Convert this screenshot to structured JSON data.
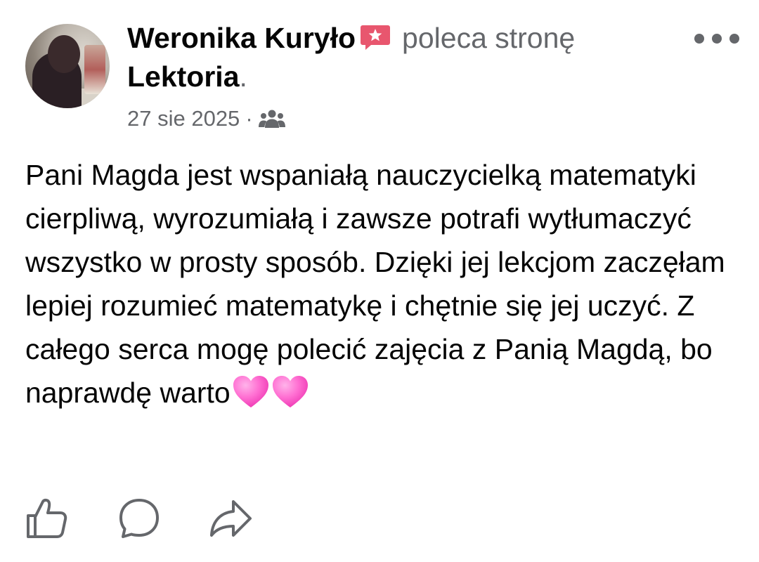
{
  "author": {
    "name": "Weronika Kuryło",
    "action_text": "poleca stronę",
    "page_name": "Lektoria",
    "end_punct": "."
  },
  "meta": {
    "date": "27 sie 2025",
    "separator": "·",
    "audience_icon": "friends-icon"
  },
  "post": {
    "text": "Pani Magda jest wspaniałą nauczycielką matematyki cierpliwą, wyrozumiałą i zawsze potrafi wytłumaczyć wszystko w prosty sposób. Dzięki jej lekcjom zaczęłam lepiej rozumieć matematykę i chętnie się jej uczyć. Z całego serca mogę polecić zajęcia z Panią Magdą, bo naprawdę warto",
    "emoji": [
      "pink-heart",
      "pink-heart"
    ]
  },
  "icons": {
    "recommend": "recommend-badge-icon",
    "more": "more-options-icon",
    "like": "like-icon",
    "comment": "comment-icon",
    "share": "share-icon"
  },
  "colors": {
    "text_primary": "#050505",
    "text_secondary": "#65676b",
    "recommend_badge": "#e8566e",
    "heart": "#ff5fcf"
  }
}
